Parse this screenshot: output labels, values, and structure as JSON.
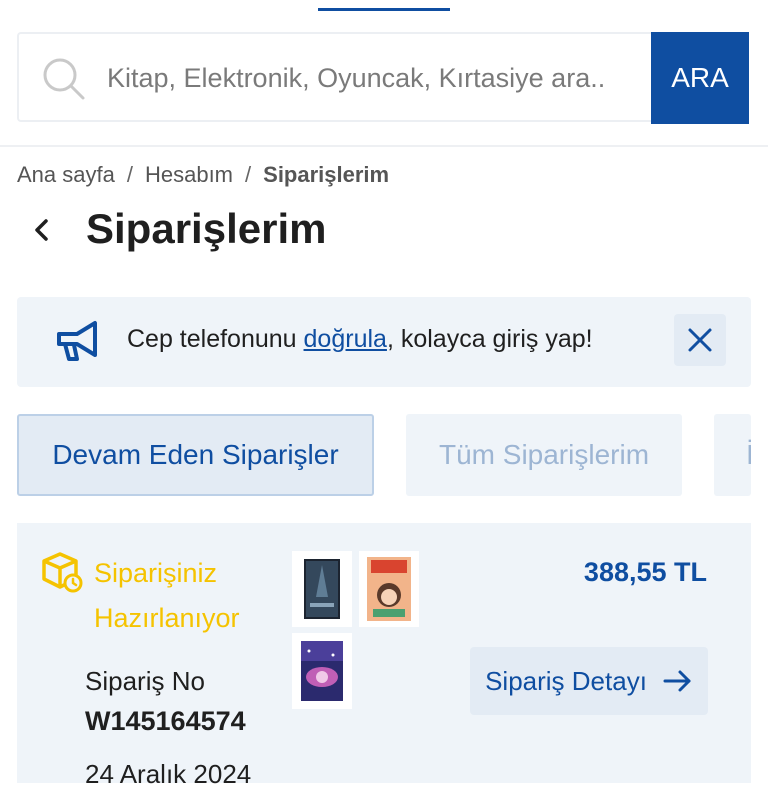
{
  "search": {
    "placeholder": "Kitap, Elektronik, Oyuncak, Kırtasiye ara..",
    "button_label": "ARA"
  },
  "breadcrumb": {
    "items": [
      "Ana sayfa",
      "Hesabım",
      "Siparişlerim"
    ],
    "separator": "/"
  },
  "page": {
    "title": "Siparişlerim"
  },
  "banner": {
    "text_before": "Cep telefonunu ",
    "link_text": "doğrula",
    "text_after": ", kolayca giriş yap!"
  },
  "tabs": [
    {
      "label": "Devam Eden Siparişler",
      "active": true
    },
    {
      "label": "Tüm Siparişlerim",
      "active": false
    },
    {
      "label": "İ",
      "active": false
    }
  ],
  "order": {
    "status_line1": "Siparişiniz",
    "status_line2": "Hazırlanıyor",
    "price": "388,55 TL",
    "order_no_label": "Sipariş No",
    "order_no": "W145164574",
    "date": "24 Aralık 2024",
    "detail_button": "Sipariş Detayı",
    "products": [
      "book-cover-dark",
      "book-cover-lupe",
      "book-cover-space"
    ]
  },
  "colors": {
    "brand_blue": "#0f4ea1",
    "status_yellow": "#f5c300",
    "panel_bg": "#eff4f9"
  },
  "icons": [
    "search-icon",
    "back-chevron-icon",
    "megaphone-icon",
    "close-icon",
    "package-icon",
    "arrow-right-icon"
  ]
}
